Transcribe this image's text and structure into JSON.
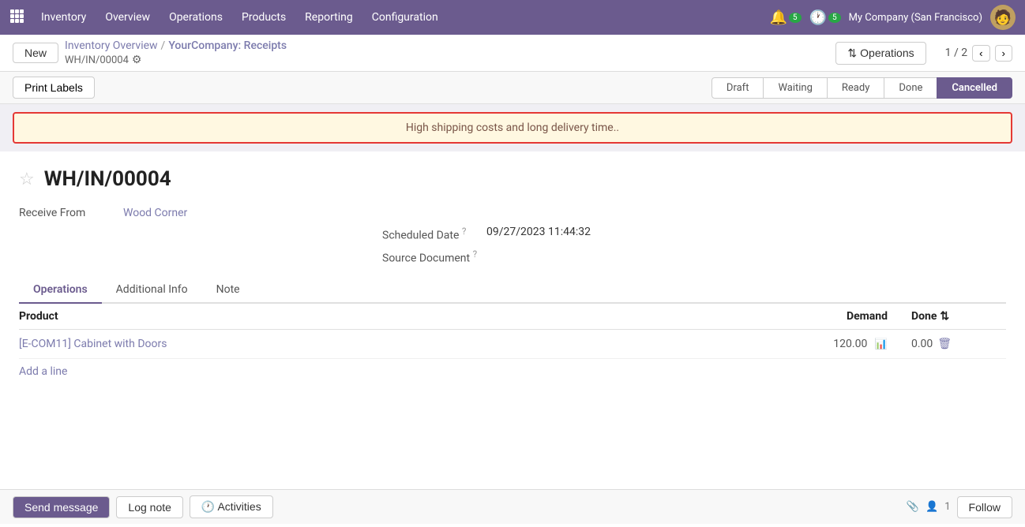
{
  "topnav": {
    "app_label": "Inventory",
    "items": [
      "Overview",
      "Operations",
      "Products",
      "Reporting",
      "Configuration"
    ],
    "notif1_count": "5",
    "notif2_count": "5",
    "company": "My Company (San Francisco)"
  },
  "breadcrumb": {
    "new_label": "New",
    "link1": "Inventory Overview",
    "separator": "/",
    "link2": "YourCompany: Receipts",
    "sub": "WH/IN/00004",
    "ops_button": "Operations",
    "pagination": "1 / 2"
  },
  "action_bar": {
    "print_label": "Print Labels",
    "statuses": [
      "Draft",
      "Waiting",
      "Ready",
      "Done",
      "Cancelled"
    ],
    "active_status": "Cancelled"
  },
  "warning": {
    "text": "High shipping costs and long delivery time.."
  },
  "record": {
    "id": "WH/IN/00004",
    "receive_from_label": "Receive From",
    "receive_from_value": "Wood Corner",
    "scheduled_date_label": "Scheduled Date",
    "scheduled_date_value": "09/27/2023 11:44:32",
    "source_doc_label": "Source Document"
  },
  "tabs": {
    "items": [
      "Operations",
      "Additional Info",
      "Note"
    ],
    "active": "Operations"
  },
  "table": {
    "col_product": "Product",
    "col_demand": "Demand",
    "col_done": "Done",
    "rows": [
      {
        "product": "[E-COM11] Cabinet with Doors",
        "demand": "120.00",
        "done": "0.00"
      }
    ],
    "add_line": "Add a line"
  },
  "chatter": {
    "send_message": "Send message",
    "log_note": "Log note",
    "activities": "Activities",
    "followers": "1",
    "follow": "Follow"
  }
}
